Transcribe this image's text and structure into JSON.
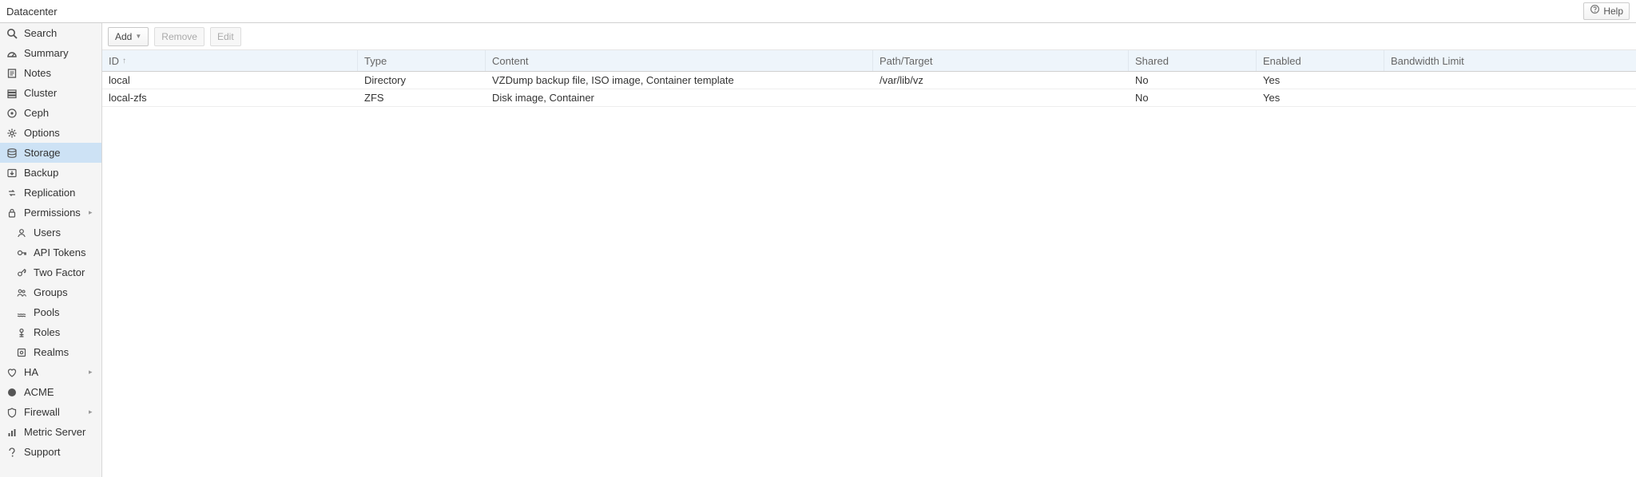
{
  "header": {
    "title": "Datacenter",
    "help_label": "Help"
  },
  "sidebar": {
    "items": [
      {
        "id": "search",
        "label": "Search",
        "icon": "search"
      },
      {
        "id": "summary",
        "label": "Summary",
        "icon": "gauge"
      },
      {
        "id": "notes",
        "label": "Notes",
        "icon": "notes"
      },
      {
        "id": "cluster",
        "label": "Cluster",
        "icon": "cluster"
      },
      {
        "id": "ceph",
        "label": "Ceph",
        "icon": "ceph"
      },
      {
        "id": "options",
        "label": "Options",
        "icon": "gear"
      },
      {
        "id": "storage",
        "label": "Storage",
        "icon": "storage",
        "selected": true
      },
      {
        "id": "backup",
        "label": "Backup",
        "icon": "backup"
      },
      {
        "id": "replication",
        "label": "Replication",
        "icon": "replication"
      },
      {
        "id": "permissions",
        "label": "Permissions",
        "icon": "permissions",
        "expandable": true
      },
      {
        "id": "users",
        "label": "Users",
        "icon": "user",
        "sub": true
      },
      {
        "id": "apitokens",
        "label": "API Tokens",
        "icon": "token",
        "sub": true
      },
      {
        "id": "twofactor",
        "label": "Two Factor",
        "icon": "key",
        "sub": true
      },
      {
        "id": "groups",
        "label": "Groups",
        "icon": "groups",
        "sub": true
      },
      {
        "id": "pools",
        "label": "Pools",
        "icon": "pools",
        "sub": true
      },
      {
        "id": "roles",
        "label": "Roles",
        "icon": "role",
        "sub": true
      },
      {
        "id": "realms",
        "label": "Realms",
        "icon": "realm",
        "sub": true
      },
      {
        "id": "ha",
        "label": "HA",
        "icon": "ha",
        "expandable": true
      },
      {
        "id": "acme",
        "label": "ACME",
        "icon": "acme"
      },
      {
        "id": "firewall",
        "label": "Firewall",
        "icon": "firewall",
        "expandable": true
      },
      {
        "id": "metric",
        "label": "Metric Server",
        "icon": "metric"
      },
      {
        "id": "support",
        "label": "Support",
        "icon": "support"
      }
    ]
  },
  "toolbar": {
    "add_label": "Add",
    "remove_label": "Remove",
    "edit_label": "Edit"
  },
  "grid": {
    "columns": {
      "id": "ID",
      "type": "Type",
      "content": "Content",
      "path": "Path/Target",
      "shared": "Shared",
      "enabled": "Enabled",
      "bw": "Bandwidth Limit"
    },
    "sort_indicator": "↑",
    "rows": [
      {
        "id": "local",
        "type": "Directory",
        "content": "VZDump backup file, ISO image, Container template",
        "path": "/var/lib/vz",
        "shared": "No",
        "enabled": "Yes",
        "bw": ""
      },
      {
        "id": "local-zfs",
        "type": "ZFS",
        "content": "Disk image, Container",
        "path": "",
        "shared": "No",
        "enabled": "Yes",
        "bw": ""
      }
    ]
  }
}
